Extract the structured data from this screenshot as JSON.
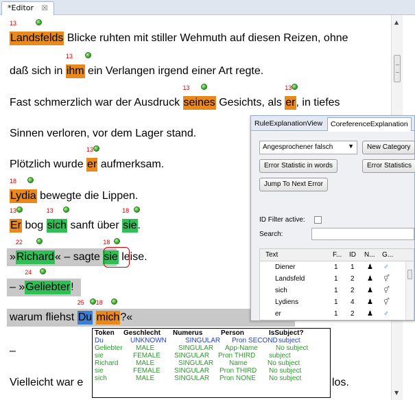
{
  "editor": {
    "tab_label": "*Editor",
    "tab_close_glyph": "☒"
  },
  "lines": {
    "l1": {
      "ann": "13",
      "tok": "Landsfelds",
      "rest": " Blicke ruhten mit stiller Wehmuth auf diesen Reizen, ohne"
    },
    "l2": {
      "pre": "daß sich in ",
      "ann": "13",
      "tok": "ihm",
      "rest": " ein Verlangen irgend einer Art regte."
    },
    "l3": {
      "pre": "Fast schmerzlich war der Ausdruck ",
      "ann1": "13",
      "tok1": "seines",
      "mid": " Gesichts, als ",
      "ann2": "13",
      "tok2": "er",
      "rest": ", in tiefes"
    },
    "l4": {
      "text": "Sinnen verloren, vor dem Lager stand."
    },
    "l5": {
      "pre": "Plötzlich wurde ",
      "ann": "13",
      "tok": "er",
      "rest": " aufmerksam."
    },
    "l6": {
      "ann": "18",
      "tok": "Lydia",
      "rest": " bewegte die Lippen."
    },
    "l7": {
      "ann1": "13",
      "tok1": "Er",
      "mid1": " bog ",
      "ann2": "13",
      "tok2": "sich",
      "mid2": " sanft über ",
      "ann3": "18",
      "tok3": "sie",
      "rest": "."
    },
    "l8": {
      "pre": "»",
      "ann1": "22",
      "tok1": "Richard",
      "mid": "« – sagte ",
      "ann2": "18",
      "tok2": "sie",
      "rest": " leise."
    },
    "l9": {
      "pre": "– »",
      "ann": "24",
      "tok": "Geliebter",
      "rest": "!"
    },
    "l10": {
      "pre": "warum fliehst ",
      "ann1": "25",
      "tok1": "Du",
      "mid": " ",
      "ann2": "18",
      "tok2": "mich",
      "rest": "?«"
    },
    "l11": {
      "text": "–"
    },
    "l12": {
      "pre": "Vielleicht war e",
      "tail": "los."
    }
  },
  "view": {
    "tab1": "RuleExplanationView",
    "tab2": "CoreferenceExplanation",
    "combo_value": "Angesprochener falsch",
    "new_category": "New Category",
    "error_stat_words": "Error Statistic in words",
    "error_statistics": "Error Statistics",
    "jump_next": "Jump To Next Error",
    "id_filter": "ID Filter active:",
    "search": "Search:",
    "columns": {
      "text": "Text",
      "f": "F...",
      "id": "ID",
      "n": "N...",
      "g": "G..."
    },
    "rows": [
      {
        "text": "Diener",
        "f": "1",
        "id": "1",
        "n": "♟",
        "g": "♂"
      },
      {
        "text": "Landsfeld",
        "f": "1",
        "id": "2",
        "n": "♟",
        "g": "⚥"
      },
      {
        "text": "sich",
        "f": "1",
        "id": "2",
        "n": "♟",
        "g": "⚥"
      },
      {
        "text": "Lydiens",
        "f": "1",
        "id": "4",
        "n": "♟",
        "g": "⚥"
      },
      {
        "text": "er",
        "f": "1",
        "id": "2",
        "n": "♟",
        "g": "♂"
      }
    ]
  },
  "tooltip": {
    "headers": {
      "token": "Token",
      "gender": "Geschlecht",
      "number": "Numerus",
      "person": "Person",
      "subject": "IsSubject?"
    },
    "rows": [
      {
        "token": "Du",
        "gender": "UNKNOWN",
        "number": "SINGULAR",
        "person": "Pron SECOND",
        "subject": "subject",
        "color": "#1f3fd0"
      },
      {
        "token": "Geliebter",
        "gender": "MALE",
        "number": "SINGULAR",
        "person": "App-Name",
        "subject": "No subject",
        "color": "#2a9a2a"
      },
      {
        "token": "sie",
        "gender": "FEMALE",
        "number": "SINGULAR",
        "person": "Pron THIRD",
        "subject": "subject",
        "color": "#2a9a2a"
      },
      {
        "token": "Richard",
        "gender": "MALE",
        "number": "SINGULAR",
        "person": "Name",
        "subject": "No subject",
        "color": "#2a9a2a"
      },
      {
        "token": "sie",
        "gender": "FEMALE",
        "number": "SINGULAR",
        "person": "Pron THIRD",
        "subject": "No subject",
        "color": "#2a9a2a"
      },
      {
        "token": "sich",
        "gender": "MALE",
        "number": "SINGULAR",
        "person": "Pron NONE",
        "subject": "No subject",
        "color": "#2a9a2a"
      }
    ]
  },
  "colors": {
    "orange": "#e8891e",
    "green": "#2fbf55",
    "blue": "#3c7fd0",
    "grey": "#c0c0c0"
  }
}
